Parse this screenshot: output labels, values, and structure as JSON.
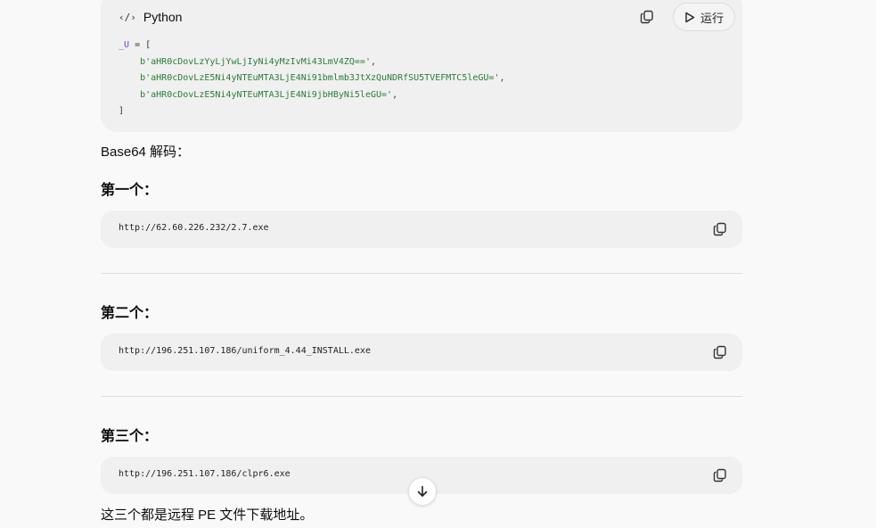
{
  "code_block": {
    "language": "Python",
    "run_label": "运行",
    "var_name": "_U",
    "assign": " = [",
    "indent": "    ",
    "strings": [
      "b'aHR0cDovLzYyLjYwLjIyNi4yMzIvMi43LmV4ZQ=='",
      "b'aHR0cDovLzE5Ni4yNTEuMTA3LjE4Ni91bmlmb3JtXzQuNDRfSU5TVEFMTC5leGU='",
      "b'aHR0cDovLzE5Ni4yNTEuMTA3LjE4Ni9jbHByNi5leGU='"
    ],
    "sep": ",",
    "close": "]"
  },
  "intro_text": "Base64 解码：",
  "sections": [
    {
      "heading": "第一个：",
      "url": "http://62.60.226.232/2.7.exe"
    },
    {
      "heading": "第二个：",
      "url": "http://196.251.107.186/uniform_4.44_INSTALL.exe"
    },
    {
      "heading": "第三个：",
      "url": "http://196.251.107.186/clpr6.exe"
    }
  ],
  "conclusion": "这三个都是远程 PE 文件下载地址。",
  "icons": {
    "code": "code-icon",
    "copy": "copy-icon",
    "play": "play-icon",
    "scroll": "arrow-down-icon"
  },
  "colors": {
    "background": "#f9f9f9",
    "card": "#f0f0f0",
    "string": "#2d7a3a",
    "variable": "#7a49c7"
  }
}
